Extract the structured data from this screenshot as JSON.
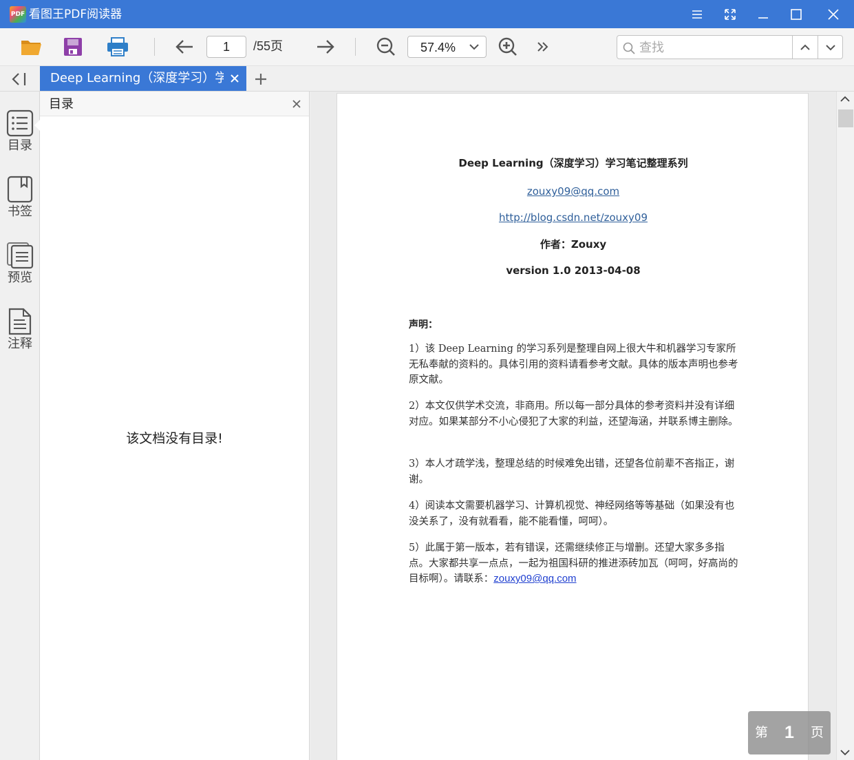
{
  "app": {
    "logo_text": "PDF",
    "title": "看图王PDF阅读器"
  },
  "toolbar": {
    "page_current": "1",
    "page_total": "/55页",
    "zoom": "57.4%",
    "search_placeholder": "查找"
  },
  "tabs": [
    {
      "label": "Deep Learning（深度学习）学习笔记整理系列"
    }
  ],
  "rail": {
    "items": [
      {
        "label": "目录",
        "icon": "toc-list-icon"
      },
      {
        "label": "书签",
        "icon": "bookmark-icon"
      },
      {
        "label": "预览",
        "icon": "thumbnail-preview-icon"
      },
      {
        "label": "注释",
        "icon": "annotation-note-icon"
      }
    ]
  },
  "toc_panel": {
    "title": "目录",
    "empty_message": "该文档没有目录!"
  },
  "document_page": {
    "title": "Deep Learning（深度学习）学习笔记整理系列",
    "email": "zouxy09@qq.com",
    "blog_url": "http://blog.csdn.net/zouxy09",
    "author": "作者：Zouxy",
    "version": "version 1.0  2013-04-08",
    "heading": "声明：",
    "paragraphs": [
      "1）该 Deep Learning 的学习系列是整理自网上很大牛和机器学习专家所无私奉献的资料的。具体引用的资料请看参考文献。具体的版本声明也参考原文献。",
      "2）本文仅供学术交流，非商用。所以每一部分具体的参考资料并没有详细对应。如果某部分不小心侵犯了大家的利益，还望海涵，并联系博主删除。",
      "3）本人才疏学浅，整理总结的时候难免出错，还望各位前辈不吝指正，谢谢。",
      "4）阅读本文需要机器学习、计算机视觉、神经网络等等基础（如果没有也没关系了，没有就看看，能不能看懂，呵呵）。",
      "5）此属于第一版本，若有错误，还需继续修正与增删。还望大家多多指点。大家都共享一点点，一起为祖国科研的推进添砖加瓦（呵呵，好高尚的目标啊）。请联系："
    ],
    "contact_email": "zouxy09@qq.com"
  },
  "page_indicator": {
    "prefix": "第",
    "number": "1",
    "suffix": "页"
  },
  "colors": {
    "accent": "#3a78d6",
    "link": "#2f5f9a",
    "folder": "#f0a830",
    "save": "#8e3fa8",
    "print": "#2f7fc8"
  }
}
